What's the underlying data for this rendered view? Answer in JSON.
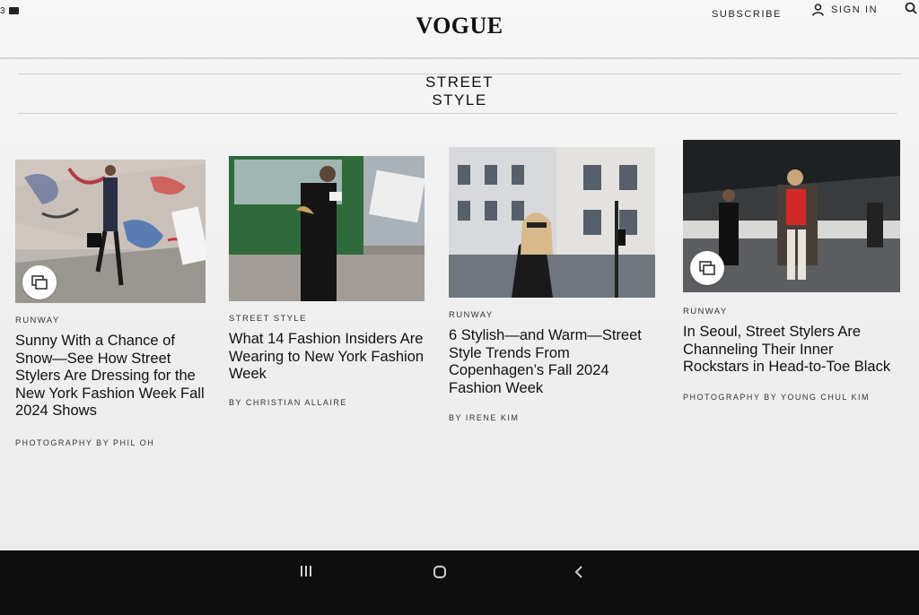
{
  "status_bar": {
    "time_fragment": "3"
  },
  "header": {
    "logo": "VOGUE",
    "subscribe_label": "SUBSCRIBE",
    "sign_in_label": "SIGN IN"
  },
  "section": {
    "title_line1": "STREET",
    "title_line2": "STYLE"
  },
  "articles": [
    {
      "category": "RUNWAY",
      "headline": "Sunny With a Chance of Snow—See How Street Stylers Are Dressing for the New York Fashion Week Fall 2024 Shows",
      "byline": "PHOTOGRAPHY BY PHIL OH",
      "gallery": true
    },
    {
      "category": "STREET STYLE",
      "headline": "What 14 Fashion Insiders Are Wearing to New York Fashion Week",
      "byline": "BY CHRISTIAN ALLAIRE",
      "gallery": false
    },
    {
      "category": "RUNWAY",
      "headline": "6 Stylish—and Warm—Street Style Trends From Copenhagen’s Fall 2024 Fashion Week",
      "byline": "BY IRENE KIM",
      "gallery": false
    },
    {
      "category": "RUNWAY",
      "headline": "In Seoul, Street Stylers Are Channeling Their Inner Rockstars in Head-to-Toe Black",
      "byline": "PHOTOGRAPHY BY YOUNG CHUL KIM",
      "gallery": true
    }
  ],
  "icons": {
    "user": "user-icon",
    "search": "search-icon",
    "gallery": "gallery-icon",
    "nav_recents": "recents-icon",
    "nav_home": "home-icon",
    "nav_back": "back-icon"
  }
}
